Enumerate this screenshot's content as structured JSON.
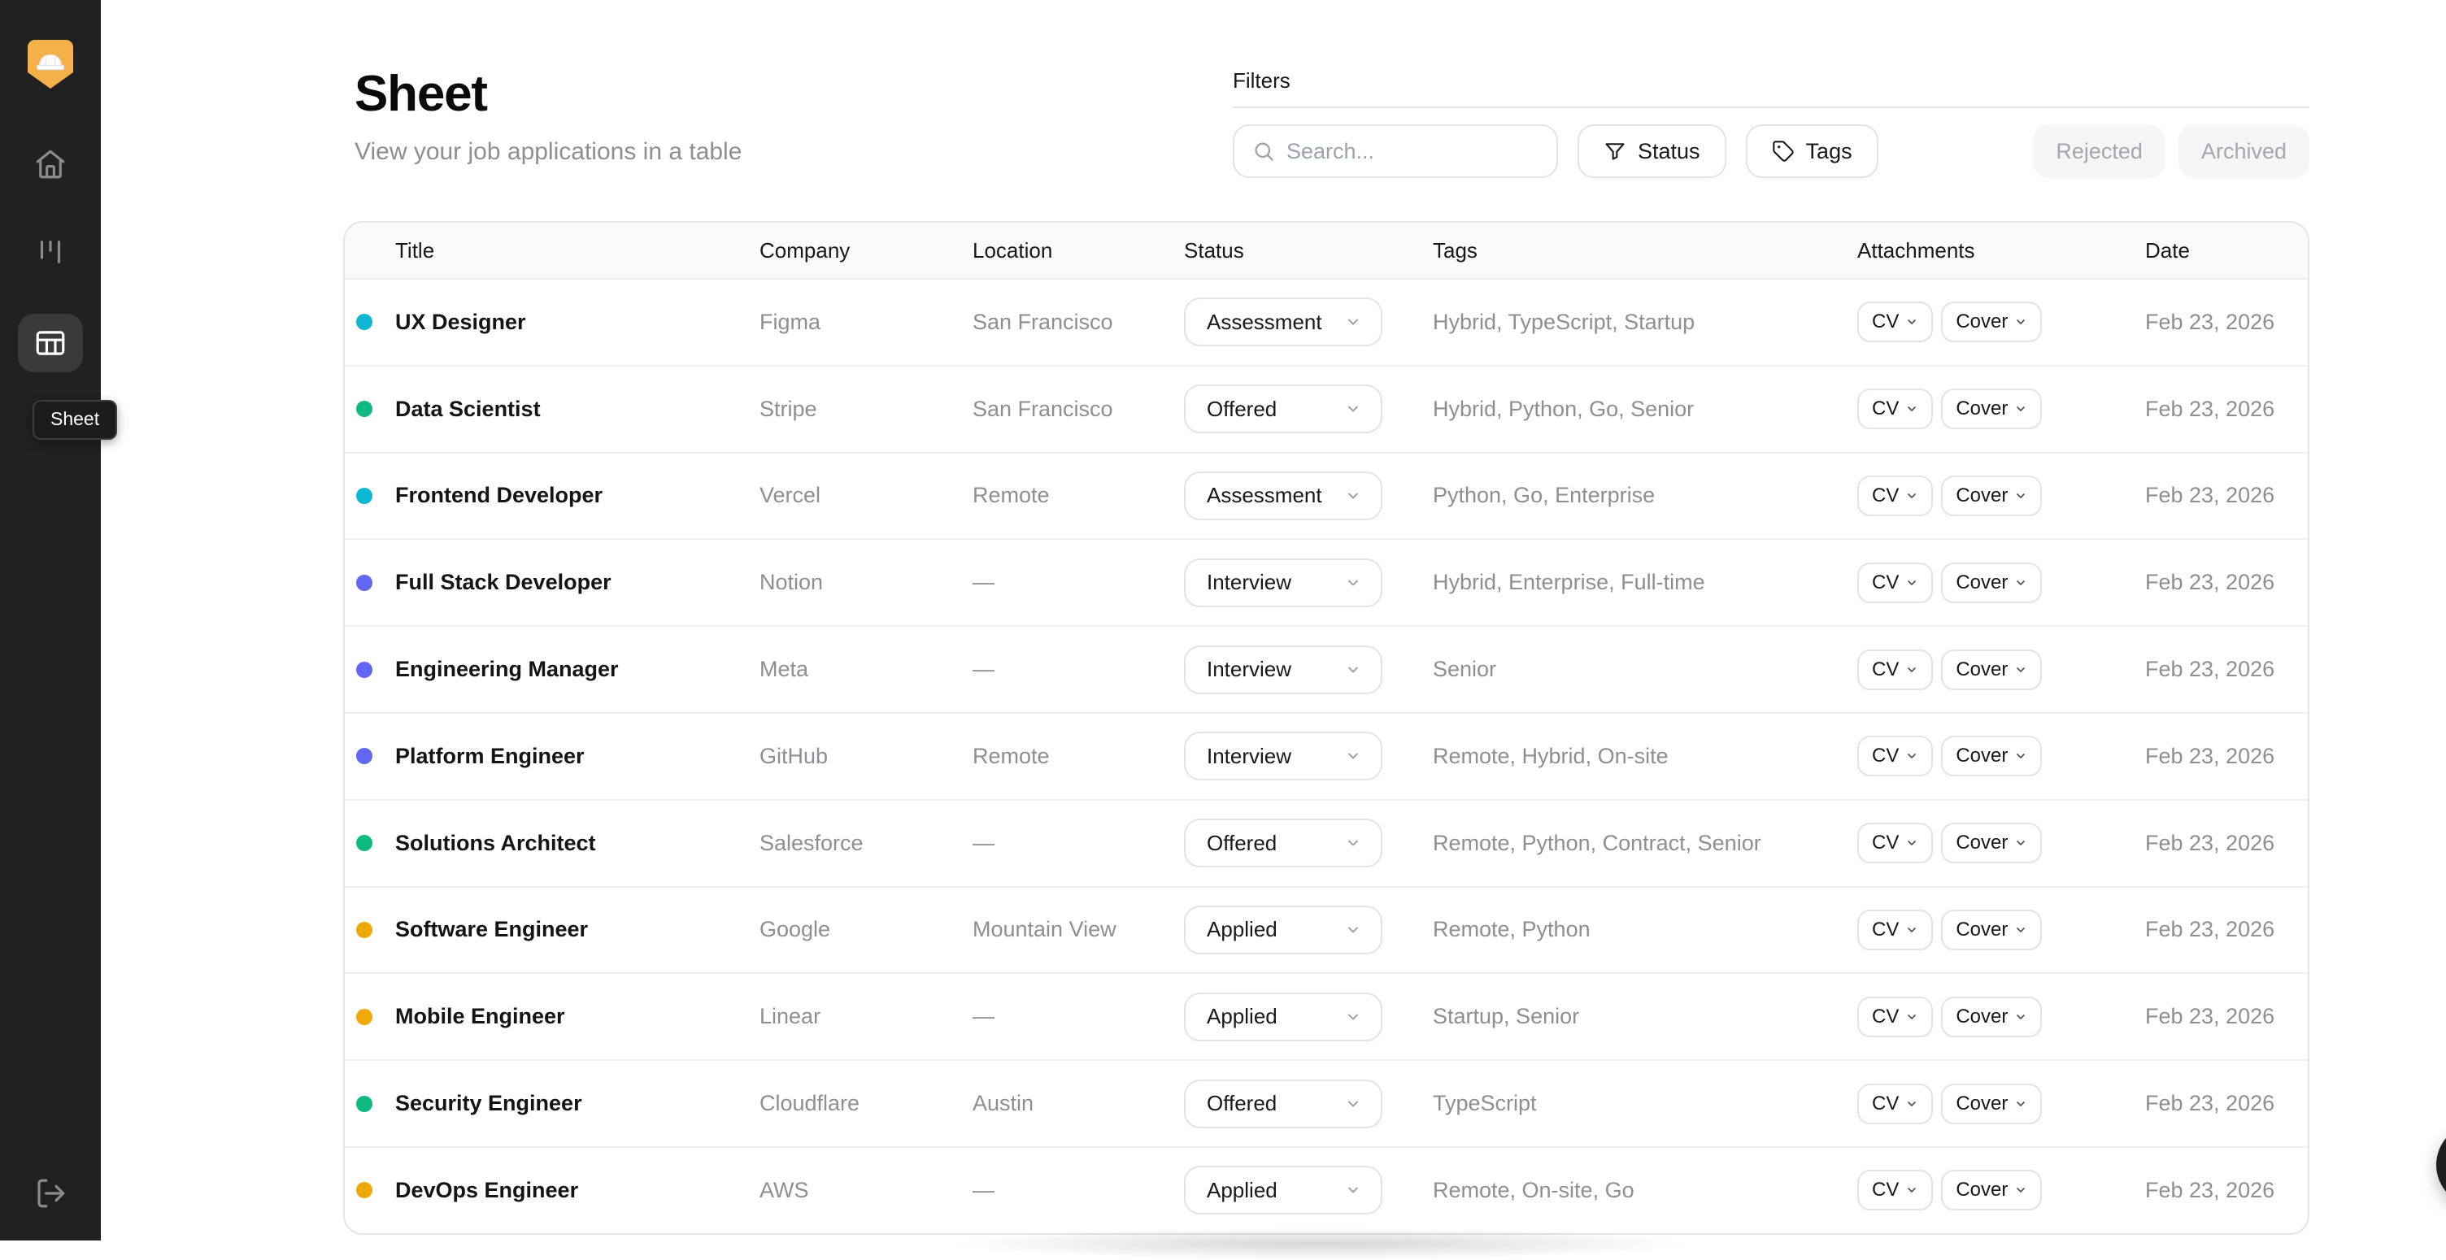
{
  "sidebar": {
    "logo": "hardhat-logo",
    "items": [
      {
        "id": "home",
        "icon": "home-icon",
        "active": false
      },
      {
        "id": "kanban",
        "icon": "kanban-icon",
        "active": false
      },
      {
        "id": "sheet",
        "icon": "table-icon",
        "active": true
      }
    ],
    "logout_icon": "logout-icon",
    "tooltip": "Sheet"
  },
  "header": {
    "title": "Sheet",
    "subtitle": "View your job applications in a table"
  },
  "filters": {
    "label": "Filters",
    "search_placeholder": "Search...",
    "status_label": "Status",
    "tags_label": "Tags",
    "rejected_label": "Rejected",
    "archived_label": "Archived"
  },
  "table": {
    "columns": [
      "Title",
      "Company",
      "Location",
      "Status",
      "Tags",
      "Attachments",
      "Date"
    ],
    "attachment_labels": [
      "CV",
      "Cover"
    ],
    "rows": [
      {
        "title": "UX Designer",
        "company": "Figma",
        "location": "San Francisco",
        "status": "Assessment",
        "tags": "Hybrid, TypeScript, Startup",
        "date": "Feb 23, 2026"
      },
      {
        "title": "Data Scientist",
        "company": "Stripe",
        "location": "San Francisco",
        "status": "Offered",
        "tags": "Hybrid, Python, Go, Senior",
        "date": "Feb 23, 2026"
      },
      {
        "title": "Frontend Developer",
        "company": "Vercel",
        "location": "Remote",
        "status": "Assessment",
        "tags": "Python, Go, Enterprise",
        "date": "Feb 23, 2026"
      },
      {
        "title": "Full Stack Developer",
        "company": "Notion",
        "location": "—",
        "status": "Interview",
        "tags": "Hybrid, Enterprise, Full-time",
        "date": "Feb 23, 2026"
      },
      {
        "title": "Engineering Manager",
        "company": "Meta",
        "location": "—",
        "status": "Interview",
        "tags": "Senior",
        "date": "Feb 23, 2026"
      },
      {
        "title": "Platform Engineer",
        "company": "GitHub",
        "location": "Remote",
        "status": "Interview",
        "tags": "Remote, Hybrid, On-site",
        "date": "Feb 23, 2026"
      },
      {
        "title": "Solutions Architect",
        "company": "Salesforce",
        "location": "—",
        "status": "Offered",
        "tags": "Remote, Python, Contract, Senior",
        "date": "Feb 23, 2026"
      },
      {
        "title": "Software Engineer",
        "company": "Google",
        "location": "Mountain View",
        "status": "Applied",
        "tags": "Remote, Python",
        "date": "Feb 23, 2026"
      },
      {
        "title": "Mobile Engineer",
        "company": "Linear",
        "location": "—",
        "status": "Applied",
        "tags": "Startup, Senior",
        "date": "Feb 23, 2026"
      },
      {
        "title": "Security Engineer",
        "company": "Cloudflare",
        "location": "Austin",
        "status": "Offered",
        "tags": "TypeScript",
        "date": "Feb 23, 2026"
      },
      {
        "title": "DevOps Engineer",
        "company": "AWS",
        "location": "—",
        "status": "Applied",
        "tags": "Remote, On-site, Go",
        "date": "Feb 23, 2026"
      }
    ]
  },
  "fab": {
    "icon": "plus-icon"
  },
  "colors": {
    "sidebar_bg": "#212121",
    "logo_amber": "#f5b04a",
    "status": {
      "Assessment": "#0cb7d4",
      "Offered": "#10b981",
      "Interview": "#6366f1",
      "Applied": "#f0a80a"
    }
  }
}
